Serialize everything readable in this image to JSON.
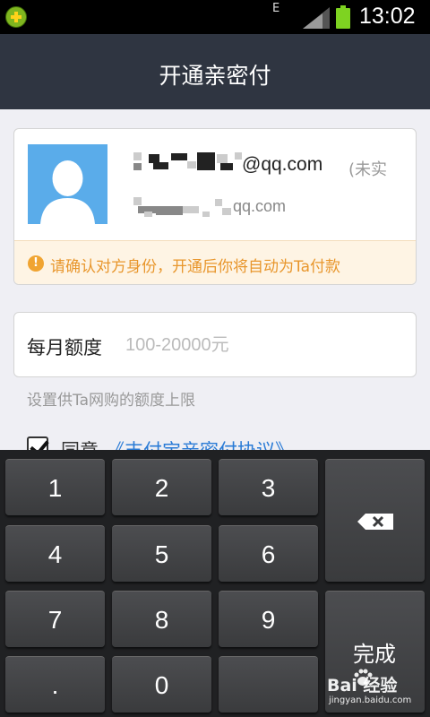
{
  "status_bar": {
    "network": "E",
    "time": "13:02",
    "app_icon": "plus-badge-icon",
    "signal_icon": "signal-icon",
    "battery_icon": "battery-icon",
    "battery_color": "#7ed321"
  },
  "header": {
    "title": "开通亲密付"
  },
  "payee": {
    "email": "@qq.com",
    "name_note": "(未实",
    "email_secondary": "qq.com",
    "avatar_icon": "default-avatar-icon",
    "avatar_color": "#5aacea",
    "warning_icon": "exclamation-icon",
    "warning_text": "请确认对方身份，开通后你将自动为Ta付款",
    "warning_color": "#e8962c"
  },
  "amount": {
    "label": "每月额度",
    "value": "",
    "placeholder": "100-20000元",
    "hint": "设置供Ta网购的额度上限"
  },
  "agreement": {
    "checked": true,
    "prefix": "同意",
    "link": "《支付宝亲密付协议》",
    "link_color": "#2a7bd6"
  },
  "keyboard": {
    "keys": [
      "1",
      "2",
      "3",
      "4",
      "5",
      "6",
      "7",
      "8",
      "9",
      ".",
      "0",
      ""
    ],
    "delete_icon": "backspace-icon",
    "done_label": "完成"
  },
  "watermark": {
    "text": "Bai 经验",
    "url": "jingyan.baidu.com"
  }
}
